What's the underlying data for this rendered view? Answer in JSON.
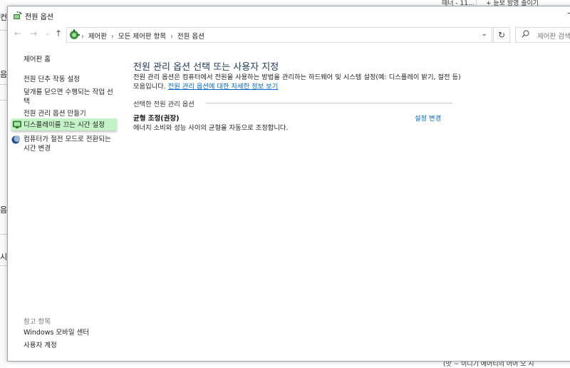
{
  "background": {
    "left_fragments": [
      "컨",
      "음",
      "음",
      "시"
    ],
    "right_top_1": "때너 - 11...",
    "right_top_2": "+ 듣보 방영 줄이기",
    "bottom_right": "(맛 ~ 이니기 에어티의 어어 오 시"
  },
  "window": {
    "title": "전원 옵션",
    "minimize": "—"
  },
  "nav": {
    "back": "←",
    "forward": "→",
    "recent": "⌄",
    "up": "↑",
    "breadcrumbs": [
      "제어판",
      "모든 제어판 항목",
      "전원 옵션"
    ],
    "separator": "›",
    "dropdown": "⌄",
    "refresh": "↻",
    "search_placeholder": "제어판 검색"
  },
  "sidebar": {
    "home": "제어판 홈",
    "items": [
      {
        "label": "전원 단추 작동 설정"
      },
      {
        "label": "덮개를 닫으면 수행되는 작업 선택"
      },
      {
        "label": "전원 관리 옵션 만들기"
      },
      {
        "label": "디스플레이를 끄는 시간 설정",
        "icon": "display-icon",
        "highlighted": true
      },
      {
        "label": "컴퓨터가 절전 모드로 전환되는 시간 변경",
        "icon": "moon-icon"
      }
    ],
    "see_also_title": "참고 항목",
    "see_also": [
      "Windows 모바일 센터",
      "사용자 계정"
    ]
  },
  "main": {
    "heading": "전원 관리 옵션 선택 또는 사용자 지정",
    "description": "전원 관리 옵션은 컴퓨터에서 전원을 사용하는 방법을 관리하는 하드웨어 및 시스템 설정(예: 디스플레이 밝기, 절전 등) 모음입니다.",
    "link": "전원 관리 옵션에 대한 자세한 정보 보기",
    "group_label": "선택한 전원 관리 옵션",
    "plan": {
      "name": "균형 조정(권장)",
      "description": "에너지 소비와 성능 사이의 균형을 자동으로 조정합니다.",
      "change": "설정 변경"
    }
  }
}
